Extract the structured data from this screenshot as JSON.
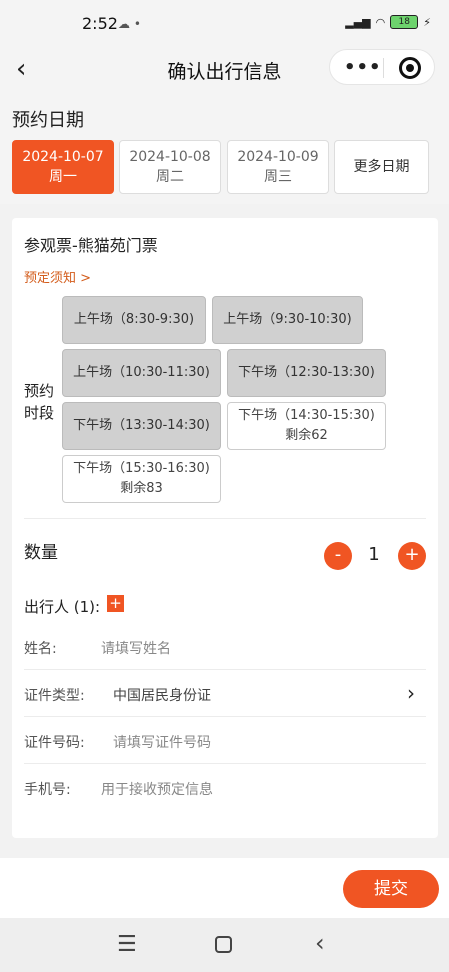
{
  "status": {
    "time": "2:52",
    "battery": "18"
  },
  "nav": {
    "back": "‹",
    "title": "确认出行信息"
  },
  "date_section": {
    "label": "预约日期",
    "dates": [
      {
        "date": "2024-10-07",
        "weekday": "周一"
      },
      {
        "date": "2024-10-08",
        "weekday": "周二"
      },
      {
        "date": "2024-10-09",
        "weekday": "周三"
      }
    ],
    "more": "更多日期"
  },
  "ticket": {
    "name": "参观票-熊猫苑门票",
    "notice": "预定须知 >",
    "slot_label": "预约时段",
    "slots": [
      {
        "text": "上午场（8:30-9:30)",
        "remain": ""
      },
      {
        "text": "上午场（9:30-10:30)",
        "remain": ""
      },
      {
        "text": "上午场（10:30-11:30)",
        "remain": ""
      },
      {
        "text": "下午场（12:30-13:30)",
        "remain": ""
      },
      {
        "text": "下午场（13:30-14:30)",
        "remain": ""
      },
      {
        "text": "下午场（14:30-15:30)",
        "remain": "剩余62"
      },
      {
        "text": "下午场（15:30-16:30)",
        "remain": "剩余83"
      }
    ]
  },
  "quantity": {
    "label": "数量",
    "minus": "-",
    "value": "1",
    "plus": "+"
  },
  "traveler": {
    "label": "出行人 (1):",
    "add": "+",
    "fields": [
      {
        "label": "姓名:",
        "value": "请填写姓名"
      },
      {
        "label": "证件类型:",
        "value": "中国居民身份证"
      },
      {
        "label": "证件号码:",
        "value": "请填写证件号码"
      },
      {
        "label": "手机号:",
        "value": "用于接收预定信息"
      }
    ]
  },
  "submit": "提交",
  "colors": {
    "accent": "#f05523",
    "notice": "#d35c1b",
    "slot_full": "#d0d0d0"
  }
}
